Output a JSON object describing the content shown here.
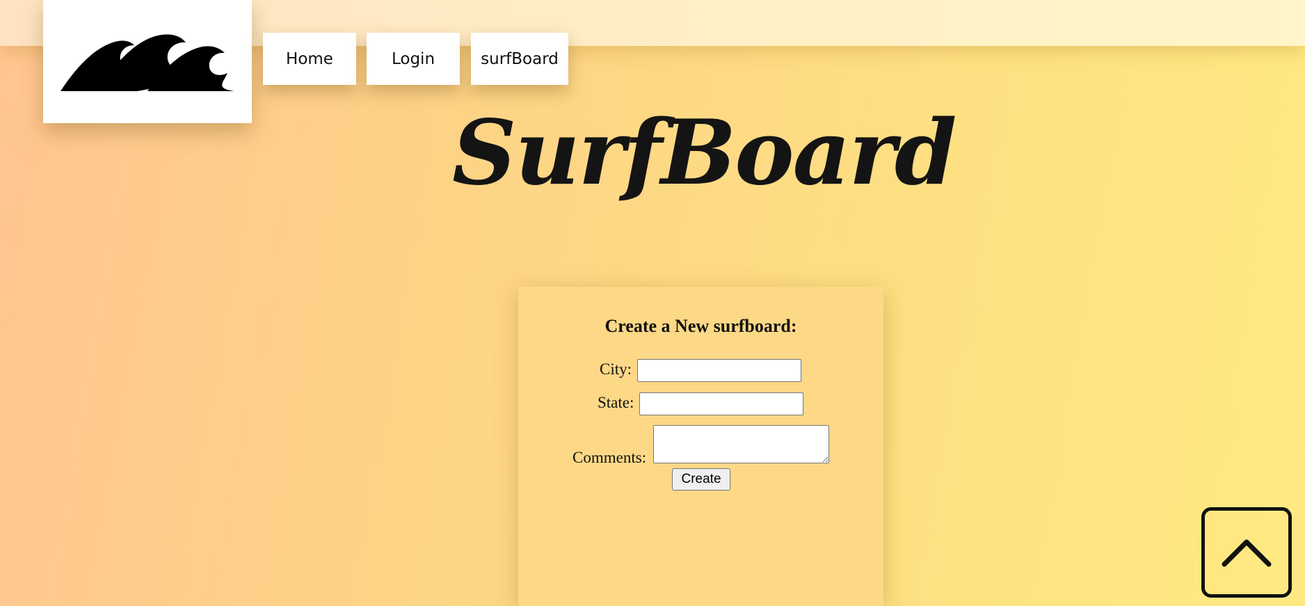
{
  "nav": {
    "home_label": "Home",
    "login_label": "Login",
    "surfboard_label": "surfBoard"
  },
  "page": {
    "title": "SurfBoard"
  },
  "form": {
    "heading": "Create a New surfboard:",
    "city_label": "City:",
    "city_value": "",
    "state_label": "State:",
    "state_value": "",
    "comments_label": "Comments:",
    "comments_value": "",
    "submit_label": "Create"
  },
  "icons": {
    "logo": "waves-logo-icon",
    "scroll_top": "chevron-up-icon"
  },
  "colors": {
    "background_start": "#ffc590",
    "background_end": "#ffea82",
    "topbar": "#fff0c6",
    "card": "#fdd886",
    "text": "#141414"
  }
}
